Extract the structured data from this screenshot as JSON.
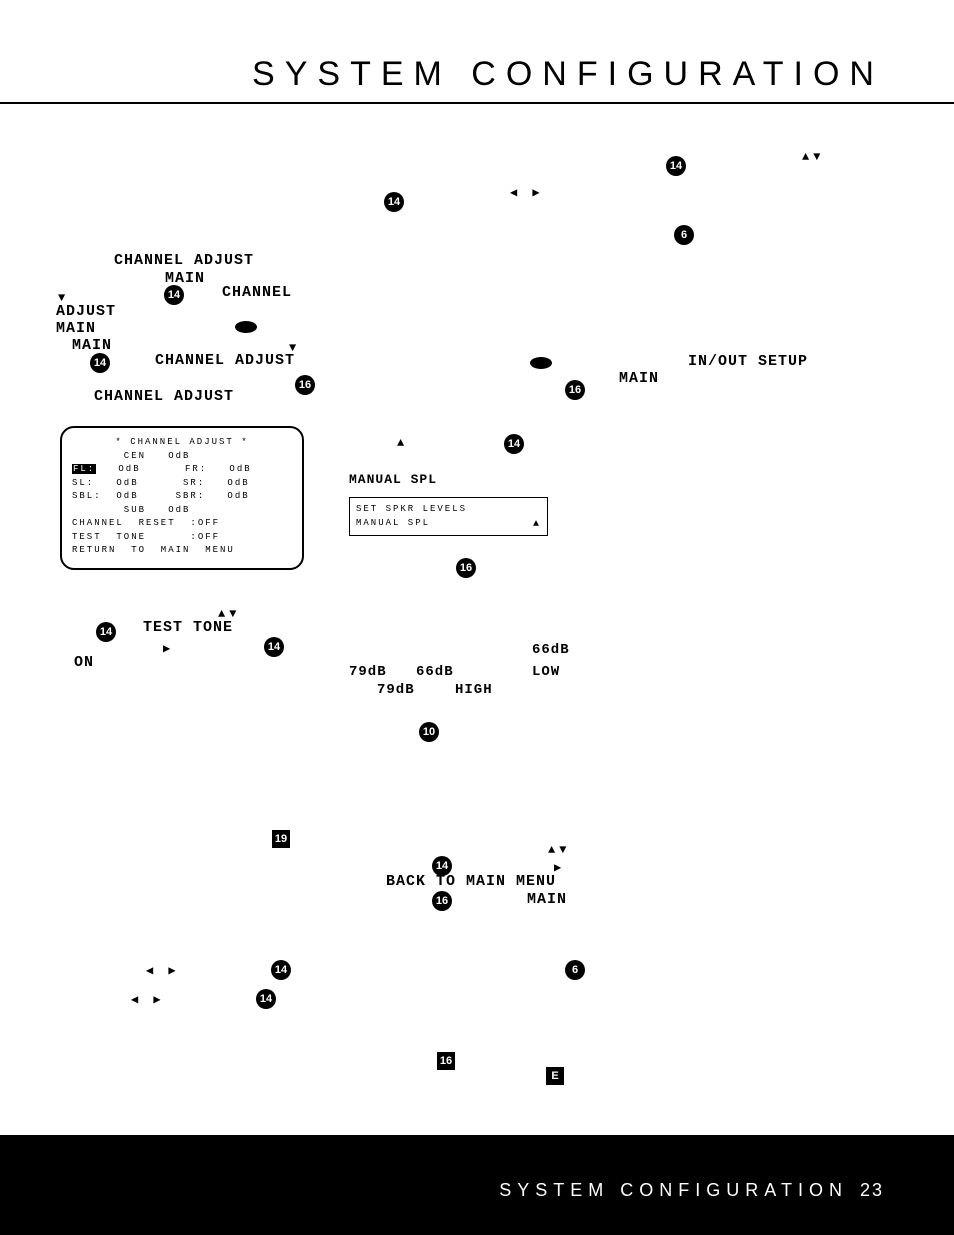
{
  "header": {
    "title": "SYSTEM CONFIGURATION"
  },
  "glyphs": {
    "up": "▲",
    "down": "▼",
    "left": "◀",
    "right": "▶",
    "updown": "▲▼",
    "leftright": "◀ ▶"
  },
  "labels": {
    "channel_adjust": "CHANNEL ADJUST",
    "main": "MAIN",
    "channel": "CHANNEL",
    "adjust": "ADJUST",
    "inout_setup": "IN/OUT SETUP",
    "manual_spl": "MANUAL SPL",
    "test_tone": "TEST TONE",
    "on": "ON",
    "back_to_main": "BACK TO MAIN MENU",
    "high": "HIGH",
    "low": "LOW",
    "v79db": "79dB",
    "v66db": "66dB"
  },
  "refs": {
    "r14": "14",
    "r16": "16",
    "r6": "6",
    "r10": "10",
    "r19": "19",
    "rE": "E"
  },
  "fig6": {
    "title": "*  CHANNEL  ADJUST  *",
    "cen_line": "       CEN   OdB",
    "fl_label": "FL:",
    "fl_rest": "   OdB      FR:   OdB",
    "sl_line": "SL:   OdB      SR:   OdB",
    "sbl_line": "SBL:  OdB     SBR:   OdB",
    "sub_line": "       SUB   OdB",
    "reset_line": "CHANNEL  RESET  :OFF",
    "tone_line": "TEST  TONE      :OFF",
    "return_line": "RETURN  TO  MAIN  MENU"
  },
  "splbox": {
    "line1": "SET SPKR LEVELS",
    "line2": "MANUAL SPL"
  },
  "footer": {
    "label": "SYSTEM CONFIGURATION",
    "page": "23"
  }
}
